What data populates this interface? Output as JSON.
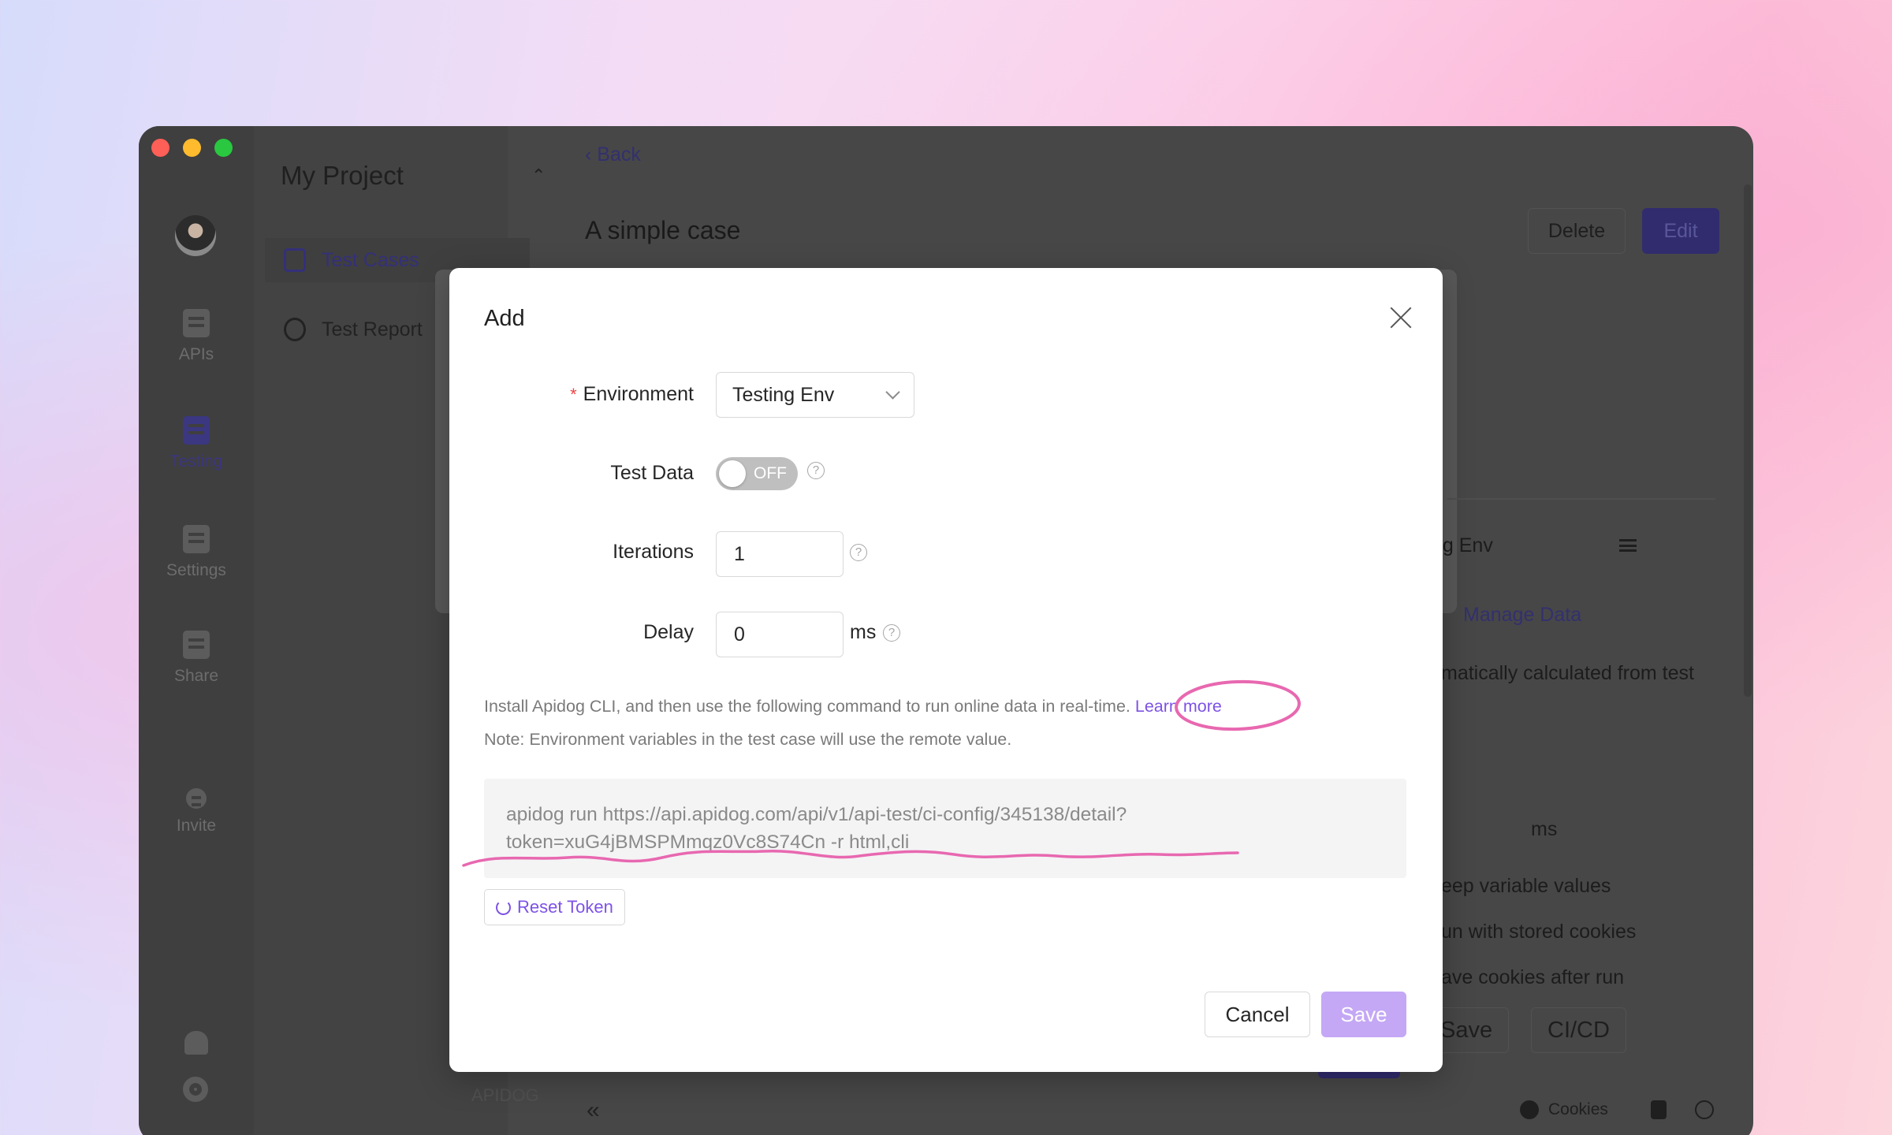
{
  "app": {
    "project_title": "My Project",
    "nav_items": [
      {
        "label": "APIs",
        "icon": "apis-icon"
      },
      {
        "label": "Testing",
        "icon": "testing-icon",
        "active": true
      },
      {
        "label": "Settings",
        "icon": "settings-icon"
      },
      {
        "label": "Share",
        "icon": "share-icon"
      },
      {
        "label": "Invite",
        "icon": "invite-icon"
      }
    ],
    "project_menu": [
      {
        "label": "Test Cases",
        "icon": "test-cases-icon",
        "active": true
      },
      {
        "label": "Test Report",
        "icon": "test-report-icon"
      }
    ],
    "watermark": "APIDOG"
  },
  "main": {
    "back_label": "Back",
    "case_title": "A simple case",
    "delete_label": "Delete",
    "edit_label": "Edit",
    "behind_texts": {
      "env": "ng Env",
      "manage_data": "Manage Data",
      "calc": "matically calculated from test",
      "ms": "ms",
      "keep_vars": "eep variable values",
      "stored_cookies": "un with stored cookies",
      "save_cookies": "ave cookies after run",
      "save_btn": "Save",
      "cicd_btn": "CI/CD"
    },
    "footer": {
      "cookies": "Cookies"
    }
  },
  "modal": {
    "title": "Add",
    "environment": {
      "label": "Environment",
      "required": true,
      "value": "Testing Env"
    },
    "test_data": {
      "label": "Test Data",
      "toggle_text": "OFF",
      "on": false
    },
    "iterations": {
      "label": "Iterations",
      "value": "1"
    },
    "delay": {
      "label": "Delay",
      "value": "0",
      "unit": "ms"
    },
    "install_note": "Install Apidog CLI, and then use the following command to run online data in real-time. ",
    "learn_more": "Learn more",
    "env_note": "Note: Environment variables in the test case will use the remote value.",
    "command_line1": "apidog run https://api.apidog.com/api/v1/api-test/ci-config/345138/detail?",
    "command_line2": "token=xuG4jBMSPMmqz0Vc8S74Cn -r html,cli",
    "reset_token_label": "Reset Token",
    "cancel_label": "Cancel",
    "save_label": "Save"
  },
  "colors": {
    "accent": "#7d52e6",
    "save_button": "#c4a8f5",
    "annotation": "#e868b0",
    "overlay": "#474747"
  }
}
